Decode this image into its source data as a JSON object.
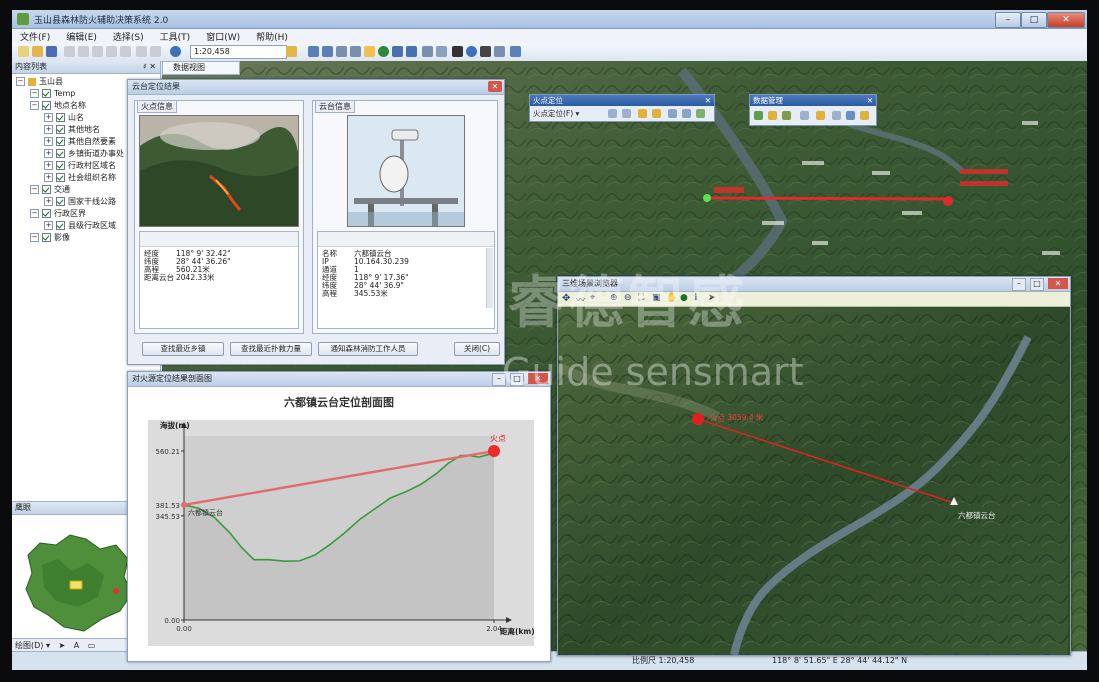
{
  "app": {
    "title": "玉山县森林防火辅助决策系统 2.0",
    "menu": [
      "文件(F)",
      "编辑(E)",
      "选择(S)",
      "工具(T)",
      "窗口(W)",
      "帮助(H)"
    ],
    "scale": "1:20,458",
    "map_tab": "数据视图"
  },
  "toc": {
    "title": "内容列表",
    "pin": "♯ ✕",
    "items": [
      {
        "label": "玉山县",
        "level": 0
      },
      {
        "label": "Temp",
        "level": 1
      },
      {
        "label": "地点名称",
        "level": 1
      },
      {
        "label": "山名",
        "level": 2
      },
      {
        "label": "其他地名",
        "level": 2
      },
      {
        "label": "其他自然要素",
        "level": 2
      },
      {
        "label": "乡镇街道办事处",
        "level": 2
      },
      {
        "label": "行政村区域名",
        "level": 2
      },
      {
        "label": "社会组织名称",
        "level": 2
      },
      {
        "label": "交通",
        "level": 1
      },
      {
        "label": "国家干线公路",
        "level": 2
      },
      {
        "label": "行政区界",
        "level": 1
      },
      {
        "label": "县级行政区域",
        "level": 2
      },
      {
        "label": "影像",
        "level": 1
      }
    ]
  },
  "overview": {
    "title": "鹰眼",
    "bar_label": "绘图(D) ▾"
  },
  "locate_window": {
    "title": "云台定位结果",
    "fire_group": "火点信息",
    "camera_group": "云台信息",
    "fire_info": [
      {
        "k": "经度",
        "v": "118° 9' 32.42\""
      },
      {
        "k": "纬度",
        "v": "28° 44' 36.26\""
      },
      {
        "k": "高程",
        "v": "560.21米"
      },
      {
        "k": "距离云台",
        "v": "2042.33米"
      }
    ],
    "camera_info": [
      {
        "k": "名称",
        "v": "六都镇云台"
      },
      {
        "k": "IP",
        "v": "10.164.30.239"
      },
      {
        "k": "通道",
        "v": "1"
      },
      {
        "k": "经度",
        "v": "118° 9' 17.36\""
      },
      {
        "k": "纬度",
        "v": "28° 44' 36.9\""
      },
      {
        "k": "高程",
        "v": "345.53米"
      }
    ],
    "buttons": [
      "查找最近乡镇",
      "查找最近扑救力量",
      "通知森林消防工作人员",
      "关闭(C)"
    ]
  },
  "float_locate": {
    "title": "火点定位",
    "dropdown": "火点定位(F) ▾"
  },
  "float_data": {
    "title": "数据管理"
  },
  "profile_window": {
    "title": "对火源定位结果剖面图",
    "chart_title": "六都镇云台定位剖面图"
  },
  "map3d_window": {
    "title": "三维场景浏览器"
  },
  "map_annotations": {
    "camera_3d": "六都镇云台",
    "fire_3d": "火点 3059.4 米"
  },
  "watermark": {
    "cn": "睿德智感",
    "en": "Guide sensmart"
  },
  "statusbar": {
    "coords": "118° 8' 51.65\" E  28° 44' 44.12\" N",
    "scale": "比例尺 1:20,458"
  },
  "chart_data": {
    "type": "area",
    "title": "六都镇云台定位剖面图",
    "xlabel": "距离(km)",
    "ylabel": "海拔(m)",
    "xlim": [
      0,
      2.04
    ],
    "ylim": [
      0,
      610
    ],
    "x_ticks": [
      "0.00",
      "2.04"
    ],
    "y_ticks": [
      "0.00",
      "345.53",
      "381.53",
      "560.21"
    ],
    "camera_label": "六都镇云台",
    "fire_label": "火点",
    "terrain": {
      "x": [
        0,
        0.1,
        0.2,
        0.3,
        0.38,
        0.46,
        0.56,
        0.66,
        0.76,
        0.86,
        0.96,
        1.06,
        1.16,
        1.26,
        1.36,
        1.46,
        1.56,
        1.66,
        1.74,
        1.82,
        1.88,
        1.94,
        2.0,
        2.04
      ],
      "y": [
        381.53,
        370,
        340,
        290,
        240,
        200,
        200,
        195,
        196,
        215,
        250,
        290,
        335,
        370,
        405,
        425,
        450,
        485,
        520,
        545,
        545,
        540,
        548,
        560.21
      ]
    },
    "sightline": {
      "x": [
        0,
        2.04
      ],
      "y": [
        381.53,
        560.21
      ]
    }
  }
}
